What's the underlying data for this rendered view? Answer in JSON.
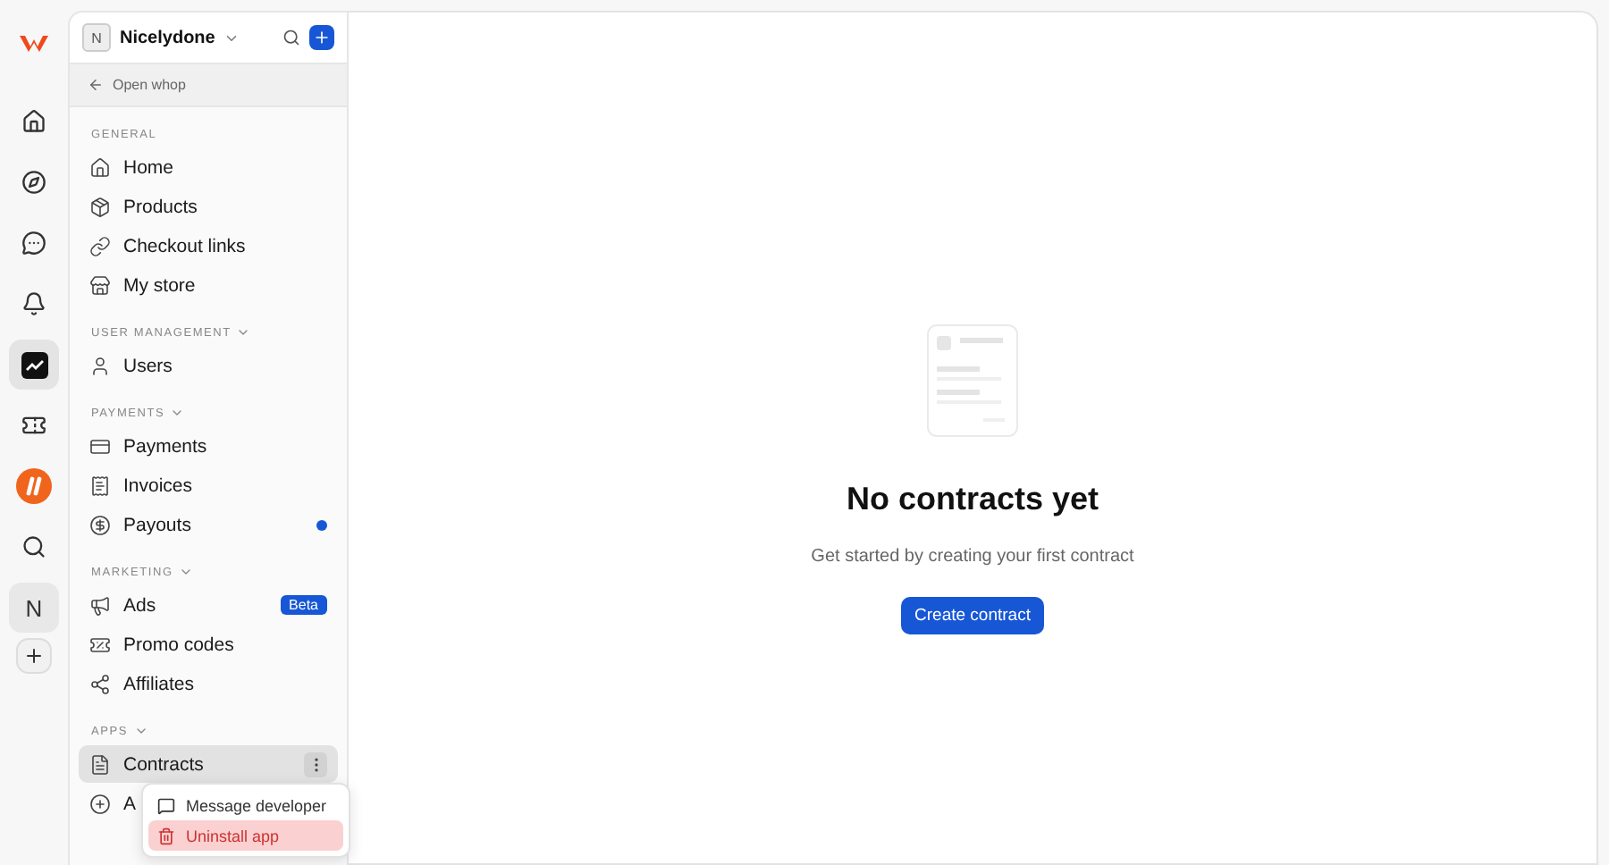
{
  "rail": [
    {
      "kind": "logo",
      "selected": false
    },
    {
      "kind": "home",
      "selected": false
    },
    {
      "kind": "explore",
      "selected": false
    },
    {
      "kind": "chat",
      "selected": false
    },
    {
      "kind": "bell",
      "selected": false
    },
    {
      "kind": "app-chart",
      "selected": true
    },
    {
      "kind": "ticket",
      "selected": false
    },
    {
      "kind": "app-orange",
      "selected": false
    },
    {
      "kind": "search",
      "selected": false
    },
    {
      "kind": "avatar",
      "label": "N",
      "selected": false
    },
    {
      "kind": "add",
      "selected": false
    }
  ],
  "workspace": {
    "initial": "N",
    "name": "Nicelydone"
  },
  "back_link": "Open whop",
  "sections": [
    {
      "label": "GENERAL",
      "collapsible": false,
      "items": [
        {
          "label": "Home",
          "selected": false,
          "unread": false
        },
        {
          "label": "Products",
          "selected": false,
          "unread": false
        },
        {
          "label": "Checkout links",
          "selected": false,
          "unread": false
        },
        {
          "label": "My store",
          "selected": false,
          "unread": false
        }
      ]
    },
    {
      "label": "USER MANAGEMENT",
      "collapsible": true,
      "items": [
        {
          "label": "Users",
          "selected": false,
          "unread": false
        }
      ]
    },
    {
      "label": "PAYMENTS",
      "collapsible": true,
      "items": [
        {
          "label": "Payments",
          "selected": false,
          "unread": false
        },
        {
          "label": "Invoices",
          "selected": false,
          "unread": false
        },
        {
          "label": "Payouts",
          "selected": false,
          "unread": true
        }
      ]
    },
    {
      "label": "MARKETING",
      "collapsible": true,
      "items": [
        {
          "label": "Ads",
          "selected": false,
          "unread": false,
          "badge": "Beta"
        },
        {
          "label": "Promo codes",
          "selected": false,
          "unread": false
        },
        {
          "label": "Affiliates",
          "selected": false,
          "unread": false
        }
      ]
    },
    {
      "label": "APPS",
      "collapsible": true,
      "items": [
        {
          "label": "Contracts",
          "selected": true,
          "unread": false,
          "menu_button": true
        },
        {
          "label": "A",
          "selected": false,
          "unread": false
        }
      ]
    }
  ],
  "context_menu": [
    {
      "label": "Message developer",
      "kind": "normal",
      "highlighted": false
    },
    {
      "label": "Uninstall app",
      "kind": "danger",
      "highlighted": true
    }
  ],
  "empty_state": {
    "title": "No contracts yet",
    "subtitle": "Get started by creating your first contract",
    "button": "Create contract"
  }
}
